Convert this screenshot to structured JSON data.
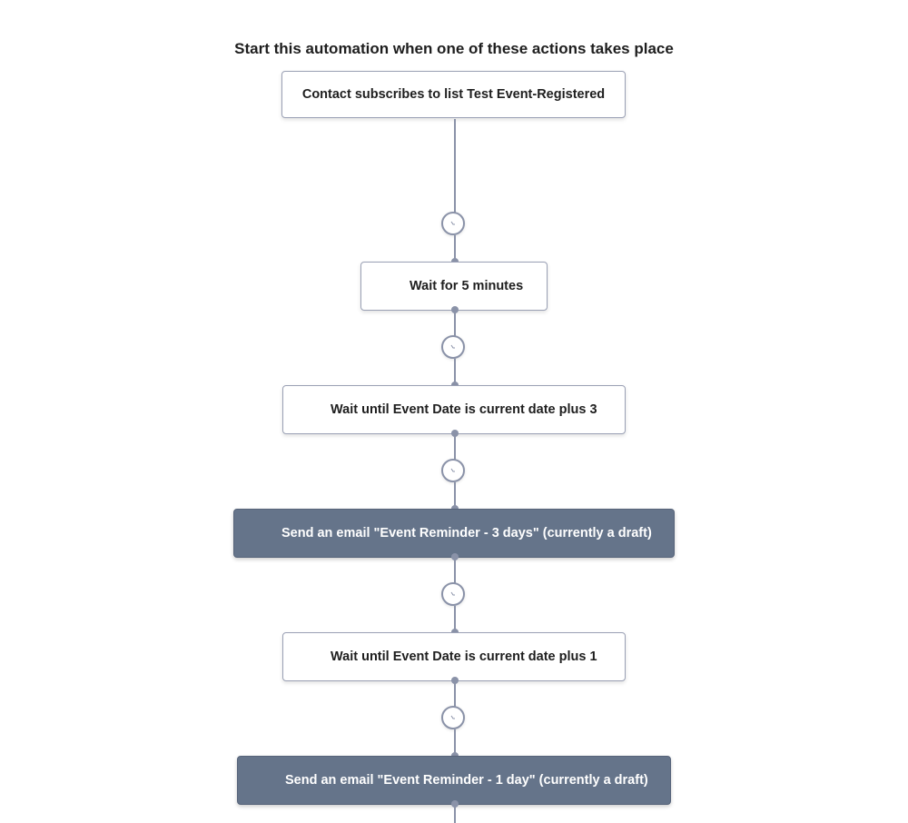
{
  "header": {
    "title": "Start this automation when one of these actions takes place"
  },
  "workflow": {
    "trigger": {
      "label": "Contact subscribes to list Test Event-Registered",
      "icon": "trigger"
    },
    "steps": [
      {
        "type": "wait",
        "label": "Wait for 5 minutes",
        "style": "light"
      },
      {
        "type": "wait",
        "label": "Wait until Event Date is current date plus 3",
        "style": "light"
      },
      {
        "type": "email",
        "label": "Send an email \"Event Reminder - 3 days\" (currently a draft)",
        "style": "dark"
      },
      {
        "type": "wait",
        "label": "Wait until Event Date is current date plus 1",
        "style": "light"
      },
      {
        "type": "email",
        "label": "Send an email \"Event Reminder - 1 day\" (currently a draft)",
        "style": "dark"
      }
    ],
    "connector_icon": "clock-icon"
  },
  "colors": {
    "connector": "#8a92a8",
    "email_node_bg": "#65748a",
    "node_border": "#9aa0b4",
    "text": "#1e1e1e"
  }
}
